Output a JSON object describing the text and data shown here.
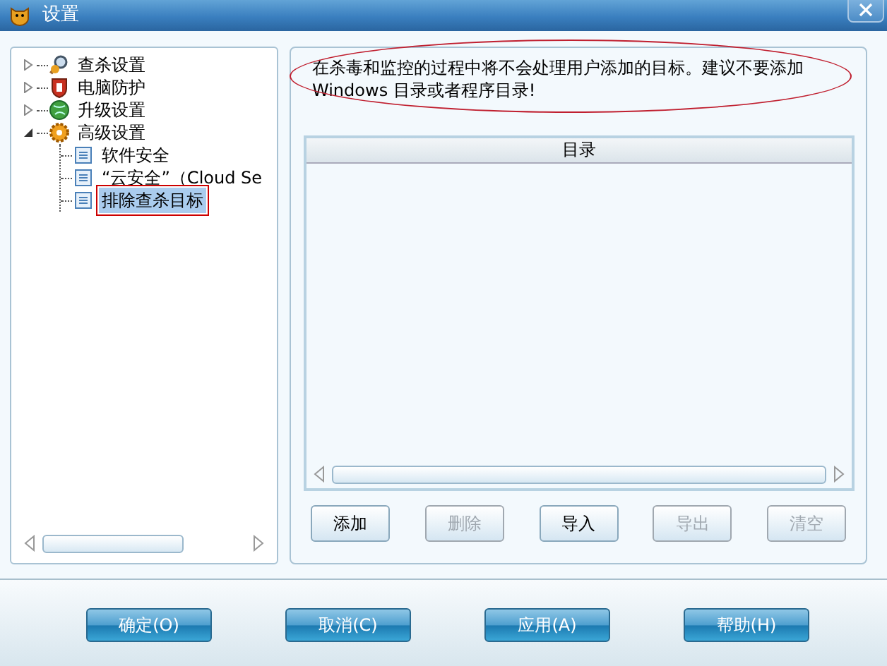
{
  "window": {
    "title": "设置"
  },
  "tree": {
    "items": [
      {
        "kind": "group",
        "label": "查杀设置",
        "expanded": false,
        "selected": false
      },
      {
        "kind": "group",
        "label": "电脑防护",
        "expanded": false,
        "selected": false
      },
      {
        "kind": "group",
        "label": "升级设置",
        "expanded": false,
        "selected": false
      },
      {
        "kind": "group",
        "label": "高级设置",
        "expanded": true,
        "selected": false,
        "children": [
          {
            "kind": "page",
            "label": "软件安全",
            "selected": false,
            "boxed": false
          },
          {
            "kind": "page",
            "label": "“云安全”（Cloud Se",
            "selected": false,
            "boxed": false
          },
          {
            "kind": "page",
            "label": "排除查杀目标",
            "selected": true,
            "boxed": true
          }
        ]
      }
    ]
  },
  "notice": {
    "text": "在杀毒和监控的过程中将不会处理用户添加的目标。建议不要添加Windows 目录或者程序目录!",
    "circled": true
  },
  "table": {
    "columns": [
      "目录"
    ]
  },
  "actions": [
    {
      "label": "添加",
      "disabled": false
    },
    {
      "label": "删除",
      "disabled": true
    },
    {
      "label": "导入",
      "disabled": false
    },
    {
      "label": "导出",
      "disabled": true
    },
    {
      "label": "清空",
      "disabled": true
    }
  ],
  "buttons": [
    "确定(O)",
    "取消(C)",
    "应用(A)",
    "帮助(H)"
  ]
}
